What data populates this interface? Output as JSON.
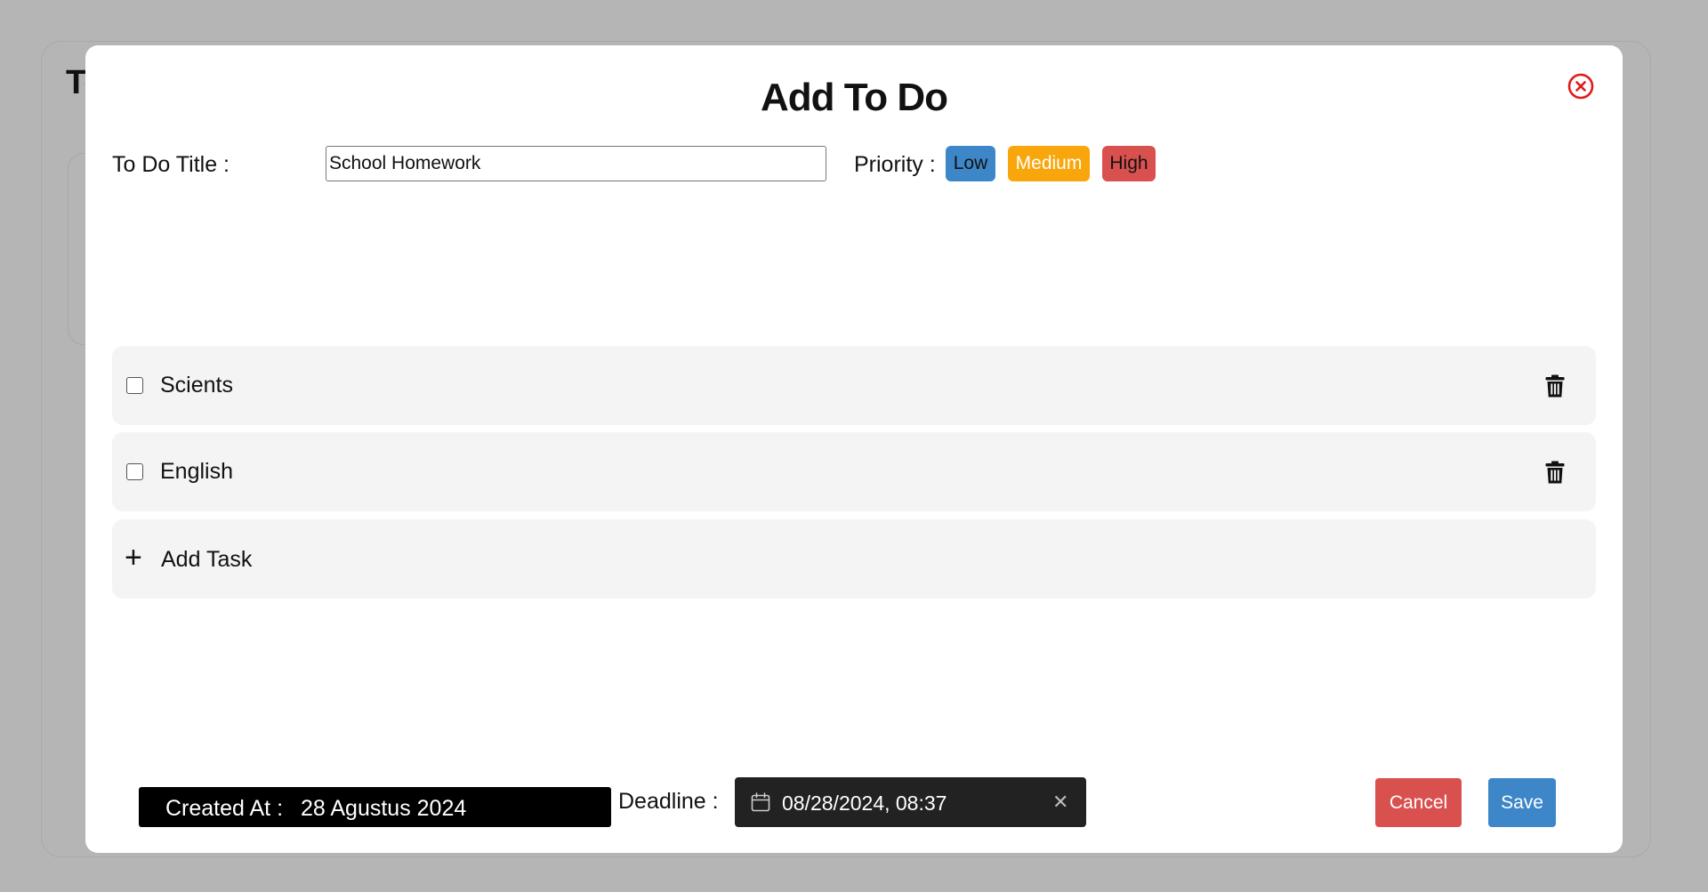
{
  "background": {
    "title": "To"
  },
  "modal": {
    "title": "Add To Do",
    "close_icon": "close-circle-icon",
    "title_label": "To Do Title :",
    "title_value": "School Homework",
    "priority_label": "Priority :",
    "priorities": [
      {
        "label": "Low",
        "color": "#3d87c9"
      },
      {
        "label": "Medium",
        "color": "#f9a60c"
      },
      {
        "label": "High",
        "color": "#d9514f"
      }
    ],
    "tasks": [
      {
        "label": "Scients",
        "checked": false
      },
      {
        "label": "English",
        "checked": false
      }
    ],
    "add_task_label": "Add Task",
    "created_label": "Created At :",
    "created_value": "28 Agustus 2024",
    "deadline_label": "Deadline :",
    "deadline_value": "08/28/2024, 08:37",
    "cancel_label": "Cancel",
    "save_label": "Save"
  }
}
